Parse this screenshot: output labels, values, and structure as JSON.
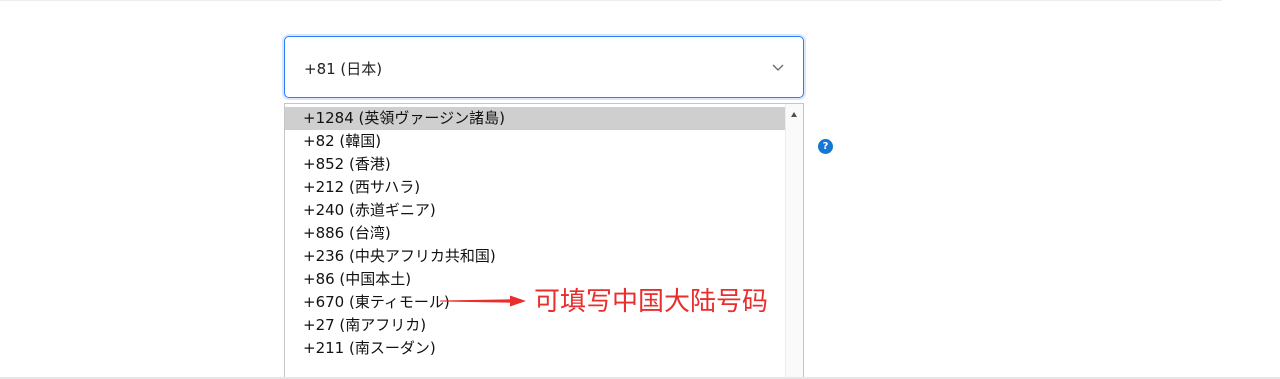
{
  "select": {
    "value": "+81 (日本)"
  },
  "dropdown": {
    "options": [
      "+1284 (英領ヴァージン諸島)",
      "+82 (韓国)",
      "+852 (香港)",
      "+212 (西サハラ)",
      "+240 (赤道ギニア)",
      "+886 (台湾)",
      "+236 (中央アフリカ共和国)",
      "+86 (中国本土)",
      "+670 (東ティモール)",
      "+27 (南アフリカ)",
      "+211 (南スーダン)"
    ],
    "highlighted_index": 0
  },
  "help": {
    "glyph": "?"
  },
  "annotation": {
    "text": "可填写中国大陆号码",
    "color": "#ea2d2d"
  },
  "colors": {
    "focus_border": "#2d7ff9",
    "highlight_background": "#cfcfcf",
    "help_icon": "#1477d4"
  },
  "icons": [
    "chevron-down-icon",
    "help-icon",
    "scroll-up-arrow-icon",
    "red-arrow-icon"
  ]
}
